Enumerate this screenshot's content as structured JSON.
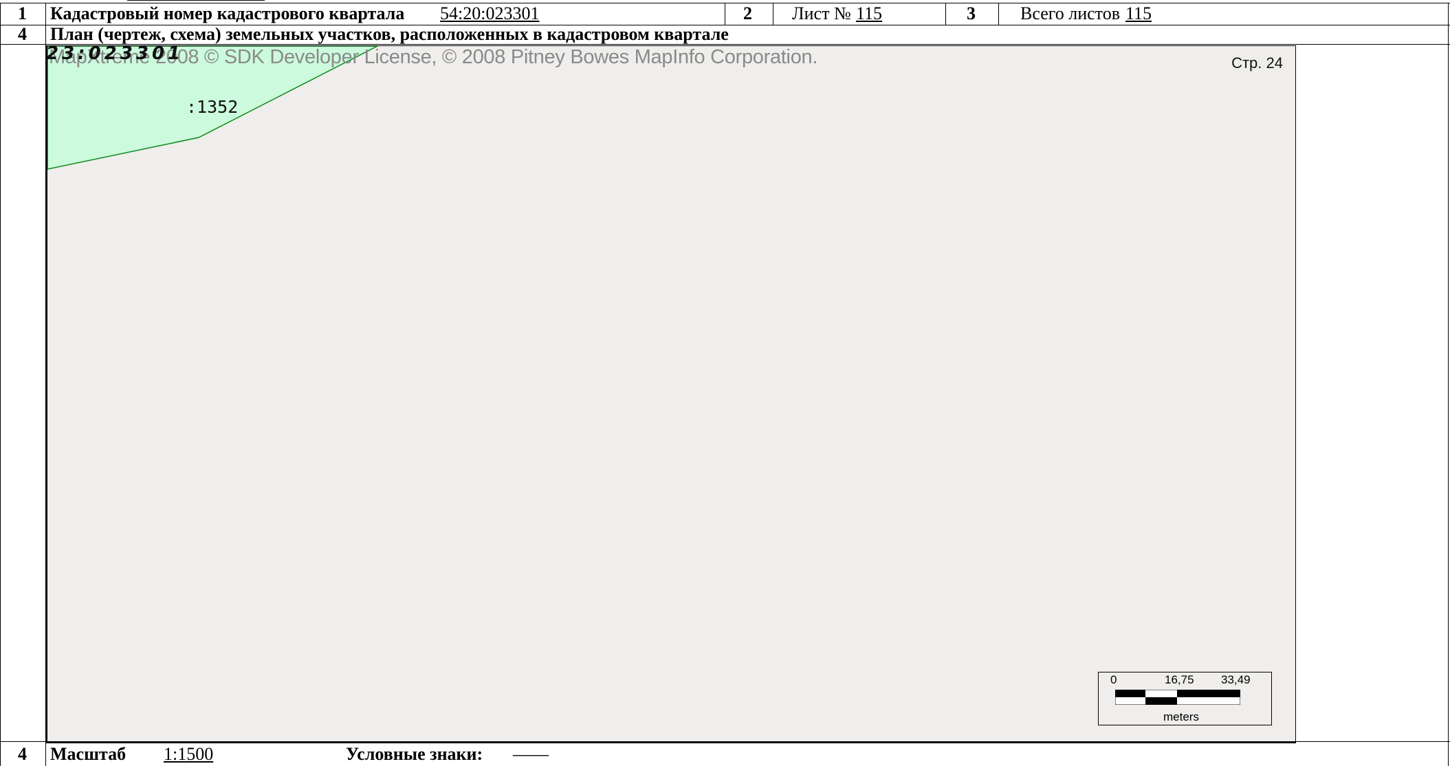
{
  "header": {
    "row1_num": "1",
    "cadastral_label": "Кадастровый номер кадастрового квартала",
    "cadastral_number": "54:20:023301",
    "field2_num": "2",
    "sheet_label": "Лист №",
    "sheet_number": "115",
    "field3_num": "3",
    "total_label": "Всего листов",
    "total_number": "115"
  },
  "plan_row": {
    "num": "4",
    "title": "План (чертеж, схема) земельных участков, расположенных в кадастровом квартале"
  },
  "map": {
    "copyright": "MapXtreme 2008 © SDK Developer License, © 2008 Pitney Bowes MapInfo Corporation.",
    "quarter_label": "23:023301",
    "page_label": "Стр. 24",
    "parcel_label": ":1352",
    "parcel_fill": "#ccfadc",
    "parcel_stroke": "#0a8a1a",
    "background": "#efeeec",
    "scale_bar": {
      "tick_0": "0",
      "tick_1": "16,75",
      "tick_2": "33,49",
      "unit": "meters"
    }
  },
  "footer": {
    "num": "4",
    "scale_label": "Масштаб",
    "scale_value": "1:1500",
    "legend_label": "Условные знаки:",
    "legend_value": "——"
  }
}
